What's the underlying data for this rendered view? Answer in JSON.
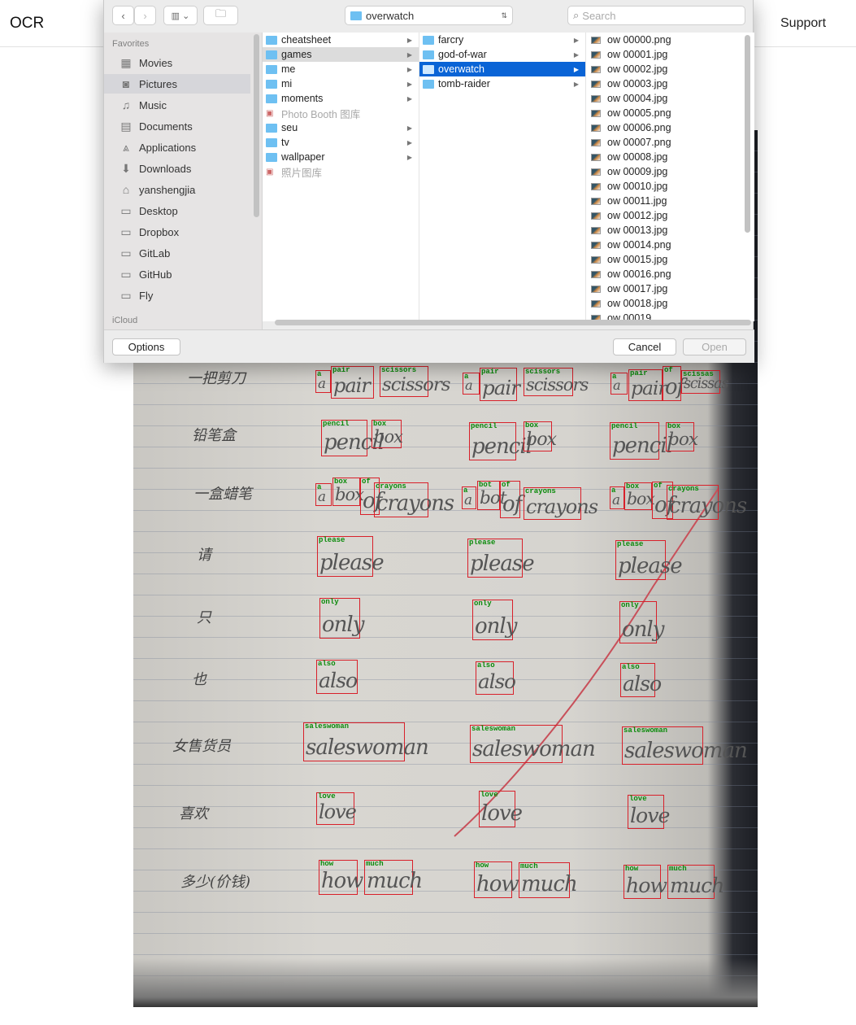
{
  "header": {
    "brand": "OCR",
    "support": "Support"
  },
  "dialog": {
    "location": "overwatch",
    "search_placeholder": "Search",
    "sidebar": {
      "favorites_label": "Favorites",
      "items": [
        {
          "label": "Movies",
          "icon": "film-icon"
        },
        {
          "label": "Pictures",
          "icon": "camera-icon"
        },
        {
          "label": "Music",
          "icon": "music-icon"
        },
        {
          "label": "Documents",
          "icon": "documents-icon"
        },
        {
          "label": "Applications",
          "icon": "applications-icon"
        },
        {
          "label": "Downloads",
          "icon": "download-icon"
        },
        {
          "label": "yanshengjia",
          "icon": "home-icon"
        },
        {
          "label": "Desktop",
          "icon": "desktop-icon"
        },
        {
          "label": "Dropbox",
          "icon": "folder-icon"
        },
        {
          "label": "GitLab",
          "icon": "folder-icon"
        },
        {
          "label": "GitHub",
          "icon": "folder-icon"
        },
        {
          "label": "Fly",
          "icon": "folder-icon"
        }
      ],
      "selected": "Pictures",
      "icloud_label": "iCloud"
    },
    "column1": [
      {
        "label": "cheatsheet"
      },
      {
        "label": "games",
        "state": "hl"
      },
      {
        "label": "me"
      },
      {
        "label": "mi"
      },
      {
        "label": "moments"
      },
      {
        "label": "Photo Booth 图库",
        "state": "dim"
      },
      {
        "label": "seu"
      },
      {
        "label": "tv"
      },
      {
        "label": "wallpaper"
      },
      {
        "label": "照片图库",
        "state": "dim"
      }
    ],
    "column2": [
      {
        "label": "farcry"
      },
      {
        "label": "god-of-war"
      },
      {
        "label": "overwatch",
        "state": "sel"
      },
      {
        "label": "tomb-raider"
      }
    ],
    "column3": [
      "ow 00000.png",
      "ow 00001.jpg",
      "ow 00002.jpg",
      "ow 00003.jpg",
      "ow 00004.jpg",
      "ow 00005.png",
      "ow 00006.png",
      "ow 00007.png",
      "ow 00008.jpg",
      "ow 00009.jpg",
      "ow 00010.jpg",
      "ow 00011.jpg",
      "ow 00012.jpg",
      "ow 00013.jpg",
      "ow 00014.png",
      "ow 00015.jpg",
      "ow 00016.png",
      "ow 00017.jpg",
      "ow 00018.jpg",
      "ow 00019"
    ],
    "options_label": "Options",
    "cancel_label": "Cancel",
    "open_label": "Open"
  },
  "photo": {
    "chinese_prompts": [
      "一把剪刀",
      "铅笔盒",
      "一盒蜡笔",
      "请",
      "只",
      "也",
      "女售货员",
      "喜欢",
      "多少(价钱)"
    ],
    "detections": [
      "a",
      "pair",
      "scissors",
      "a",
      "pair",
      "scissors",
      "a",
      "pair",
      "of",
      "scissas",
      "pencil",
      "box",
      "pencil",
      "box",
      "pencil",
      "box",
      "a",
      "box",
      "of",
      "crayons",
      "a",
      "bot",
      "of",
      "crayons",
      "a",
      "box",
      "of",
      "crayons",
      "please",
      "please",
      "please",
      "only",
      "only",
      "only",
      "also",
      "also",
      "also",
      "saleswoman",
      "saleswoman",
      "saleswoman",
      "love",
      "love",
      "love",
      "how",
      "much",
      "how",
      "much",
      "how",
      "much"
    ],
    "accent_box": "#d8202a",
    "accent_label": "#0a8a0a"
  }
}
